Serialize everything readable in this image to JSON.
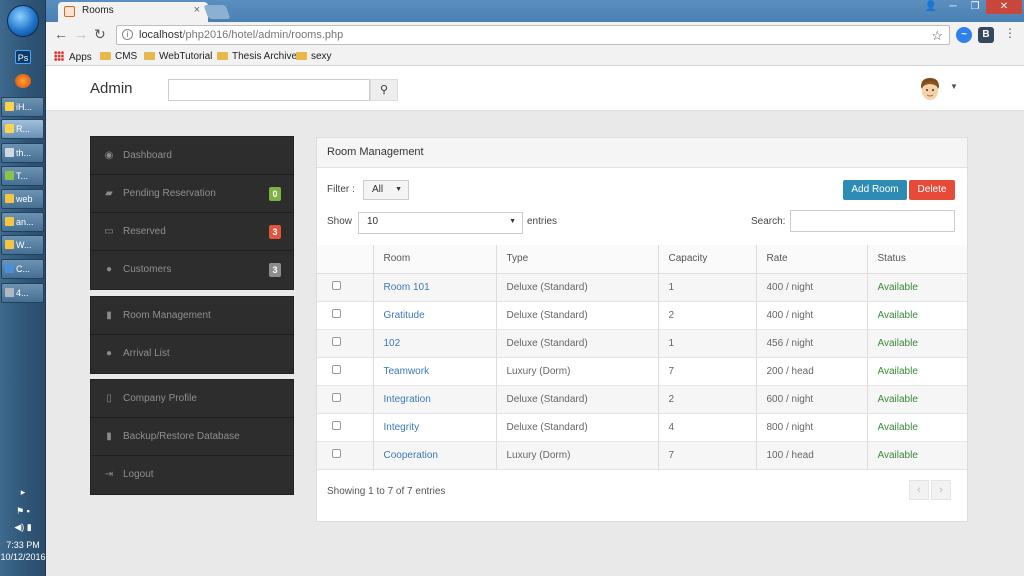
{
  "taskbar": {
    "icons": [
      "Ps"
    ],
    "buttons": [
      "iH...",
      "R...",
      "th...",
      "T...",
      "web",
      "an...",
      "W...",
      "C...",
      "4..."
    ],
    "clock_time": "7:33 PM",
    "clock_date": "10/12/2016"
  },
  "browser": {
    "tab_title": "Rooms",
    "url_host": "localhost",
    "url_path": "/php2016/hotel/admin/rooms.php",
    "bookmarks": [
      "Apps",
      "CMS",
      "WebTutorial",
      "Thesis Archive",
      "sexy"
    ]
  },
  "app": {
    "brand": "Admin",
    "search_placeholder": ""
  },
  "sidebar": {
    "group1": [
      {
        "label": "Dashboard",
        "badge": ""
      },
      {
        "label": "Pending Reservation",
        "badge": "0",
        "badge_color": "#7cb342"
      },
      {
        "label": "Reserved",
        "badge": "3",
        "badge_color": "#e1553a"
      },
      {
        "label": "Customers",
        "badge": "3",
        "badge_color": "#8d8d8d"
      }
    ],
    "group2": [
      {
        "label": "Room Management"
      },
      {
        "label": "Arrival List"
      }
    ],
    "group3": [
      {
        "label": "Company Profile"
      },
      {
        "label": "Backup/Restore Database"
      },
      {
        "label": "Logout"
      }
    ]
  },
  "panel": {
    "title": "Room Management",
    "filter_label": "Filter :",
    "filter_value": "All",
    "show_label": "Show",
    "show_value": "10",
    "entries_label": "entries",
    "search_label": "Search:",
    "add_button": "Add Room",
    "delete_button": "Delete",
    "columns": [
      "Room",
      "Type",
      "Capacity",
      "Rate",
      "Status"
    ],
    "rows": [
      {
        "room": "Room 101",
        "type": "Deluxe (Standard)",
        "capacity": "1",
        "rate": "400 / night",
        "status": "Available"
      },
      {
        "room": "Gratitude",
        "type": "Deluxe (Standard)",
        "capacity": "2",
        "rate": "400 / night",
        "status": "Available"
      },
      {
        "room": "102",
        "type": "Deluxe (Standard)",
        "capacity": "1",
        "rate": "456 / night",
        "status": "Available"
      },
      {
        "room": "Teamwork",
        "type": "Luxury (Dorm)",
        "capacity": "7",
        "rate": "200 / head",
        "status": "Available"
      },
      {
        "room": "Integration",
        "type": "Deluxe (Standard)",
        "capacity": "2",
        "rate": "600 / night",
        "status": "Available"
      },
      {
        "room": "Integrity",
        "type": "Deluxe (Standard)",
        "capacity": "4",
        "rate": "800 / night",
        "status": "Available"
      },
      {
        "room": "Cooperation",
        "type": "Luxury (Dorm)",
        "capacity": "7",
        "rate": "100 / head",
        "status": "Available"
      }
    ],
    "info": "Showing 1 to 7 of 7 entries"
  },
  "colors": {
    "add_button": "#2e8bb4",
    "delete_button": "#e84a3a",
    "link": "#3c79b5",
    "available": "#3a8a3a"
  }
}
